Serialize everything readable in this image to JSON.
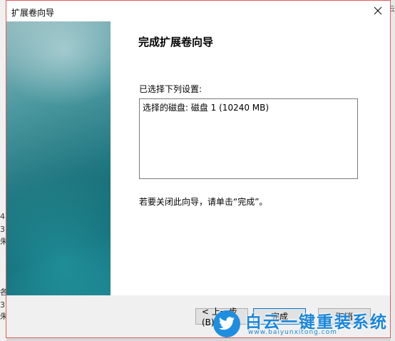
{
  "background": {
    "left_fragments": [
      "4",
      "3",
      "朱",
      "各",
      "3",
      "朱"
    ],
    "right_fragment": "云"
  },
  "window": {
    "title": "扩展卷向导"
  },
  "wizard": {
    "heading": "完成扩展卷向导",
    "summary_label": "已选择下列设置:",
    "summary_text": "选择的磁盘: 磁盘 1 (10240 MB)",
    "finish_hint": "若要关闭此向导，请单击“完成”。"
  },
  "buttons": {
    "back": "< 上一步(B)",
    "finish": "完成",
    "cancel": "取消"
  },
  "watermark": {
    "title": "白云一键重装系统",
    "url": "www.baiyunxitong.com"
  },
  "colors": {
    "window_border": "#e35a5a",
    "panel_teal": "#1f767f",
    "watermark_blue": "#1a86d8"
  }
}
